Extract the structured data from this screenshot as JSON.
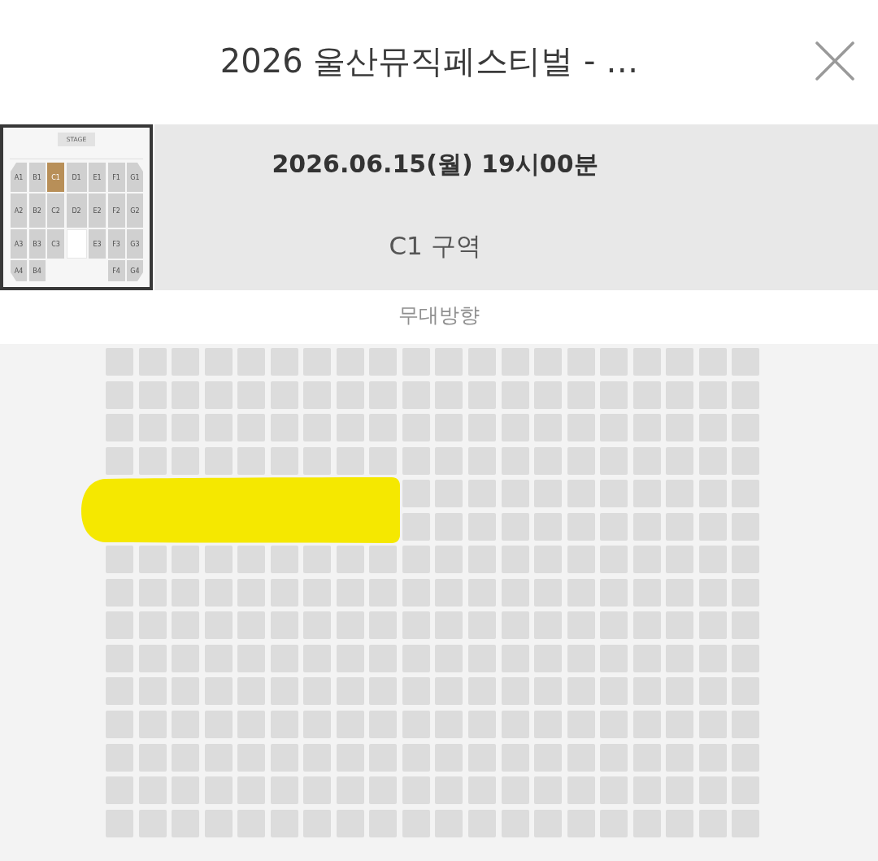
{
  "header": {
    "title": "2026 울산뮤직페스티벌 - …"
  },
  "event": {
    "thumbnail": {
      "stage_label": "STAGE",
      "rows": [
        [
          {
            "kind": "section",
            "label": "A1",
            "selected": false
          },
          {
            "kind": "section",
            "label": "B1",
            "selected": false
          },
          {
            "kind": "section",
            "label": "C1",
            "selected": true
          },
          {
            "kind": "section",
            "label": "D1",
            "selected": false
          },
          {
            "kind": "section",
            "label": "E1",
            "selected": false
          },
          {
            "kind": "section",
            "label": "F1",
            "selected": false
          },
          {
            "kind": "section",
            "label": "G1",
            "selected": false
          }
        ],
        [
          {
            "kind": "section",
            "label": "A2",
            "selected": false
          },
          {
            "kind": "section",
            "label": "B2",
            "selected": false
          },
          {
            "kind": "section",
            "label": "C2",
            "selected": false
          },
          {
            "kind": "section",
            "label": "D2",
            "selected": false
          },
          {
            "kind": "section",
            "label": "E2",
            "selected": false
          },
          {
            "kind": "section",
            "label": "F2",
            "selected": false
          },
          {
            "kind": "section",
            "label": "G2",
            "selected": false
          }
        ],
        [
          {
            "kind": "section",
            "label": "A3",
            "selected": false
          },
          {
            "kind": "section",
            "label": "B3",
            "selected": false
          },
          {
            "kind": "section",
            "label": "C3",
            "selected": false
          },
          {
            "kind": "console"
          },
          {
            "kind": "section",
            "label": "E3",
            "selected": false
          },
          {
            "kind": "section",
            "label": "F3",
            "selected": false
          },
          {
            "kind": "section",
            "label": "G3",
            "selected": false
          }
        ],
        [
          {
            "kind": "section",
            "label": "A4",
            "selected": false
          },
          {
            "kind": "section",
            "label": "B4",
            "selected": false
          },
          {
            "kind": "empty"
          },
          {
            "kind": "empty"
          },
          {
            "kind": "empty"
          },
          {
            "kind": "section",
            "label": "F4",
            "selected": false
          },
          {
            "kind": "section",
            "label": "G4",
            "selected": false
          }
        ]
      ]
    },
    "date_time": "2026.06.15(월) 19시00분",
    "zone": "C1 구역"
  },
  "stage_direction": "무대방향",
  "seat_map": {
    "highlight_scribble": true
  }
}
